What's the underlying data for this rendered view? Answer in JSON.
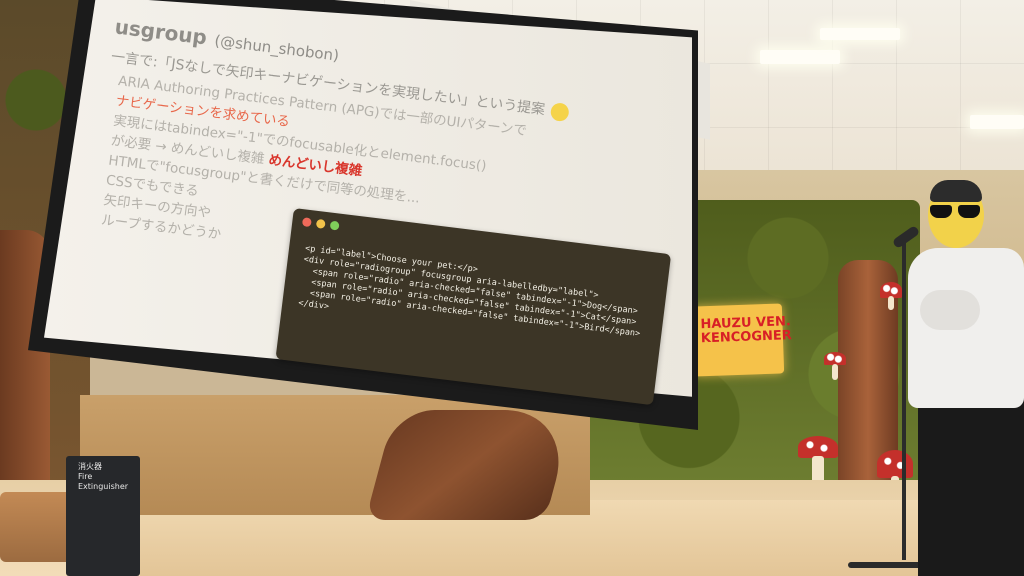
{
  "slide": {
    "title": "usgroup",
    "handle": "(@shun_shobon)",
    "subtitle": "一言で:「JSなしで矢印キーナビゲーションを実現したい」という提案",
    "bullets": [
      "ARIA Authoring Practices Pattern (APG)では一部のUIパターンで",
      "ナビゲーションを求めている",
      "実現にはtabindex=\"-1\"でのfocusable化とelement.focus()",
      "が必要 → めんどいし複雑",
      "HTMLで\"focusgroup\"と書くだけで同等の処理を...",
      "CSSでもできる",
      "矢印キーの方向や",
      "ループするかどうか"
    ],
    "accent_phrase": "ナビゲーション",
    "red_phrase": "めんどいし複雑",
    "code_lines": [
      "<p id=\"label\">Choose your pet:</p>",
      "<div role=\"radiogroup\" focusgroup aria-labelledby=\"label\">",
      "  <span role=\"radio\" aria-checked=\"false\" tabindex=\"-1\">Dog</span>",
      "  <span role=\"radio\" aria-checked=\"false\" tabindex=\"-1\">Cat</span>",
      "  <span role=\"radio\" aria-checked=\"false\" tabindex=\"-1\">Bird</span>",
      "</div>"
    ]
  },
  "sign": {
    "text": "HAUZU VEN. KENCOGNER"
  },
  "extinguisher": {
    "label_jp": "消火器",
    "label_en": "Fire Extinguisher"
  },
  "colors": {
    "accent": "#e8684b",
    "red": "#d9362c",
    "code_bg": "#3c3526"
  }
}
